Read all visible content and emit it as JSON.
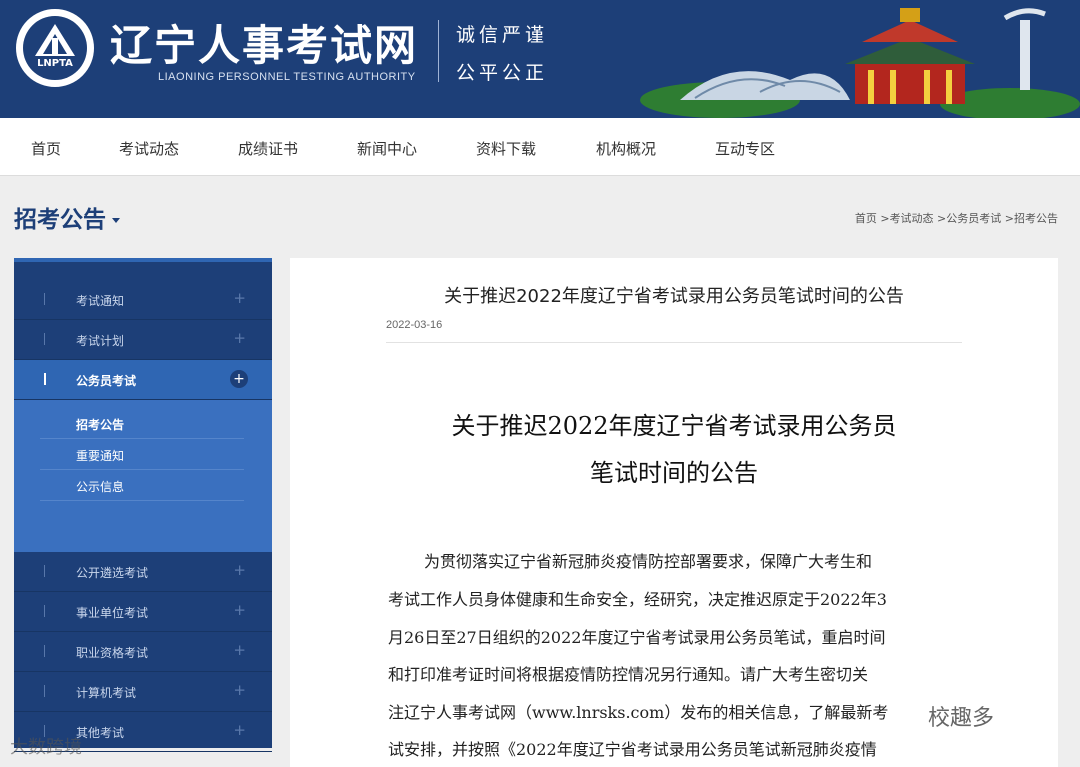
{
  "header": {
    "logo_text": "LNPTA",
    "site_title": "辽宁人事考试网",
    "site_subtitle": "LIAONING PERSONNEL TESTING AUTHORITY",
    "motto_line1": "诚信严谨",
    "motto_line2": "公平公正",
    "background_color": "#1d3f78"
  },
  "nav": {
    "items": [
      {
        "label": "首页"
      },
      {
        "label": "考试动态"
      },
      {
        "label": "成绩证书"
      },
      {
        "label": "新闻中心"
      },
      {
        "label": "资料下载"
      },
      {
        "label": "机构概况"
      },
      {
        "label": "互动专区"
      }
    ]
  },
  "section": {
    "title": "招考公告",
    "breadcrumb": [
      {
        "label": "首页"
      },
      {
        "label": "考试动态"
      },
      {
        "label": "公务员考试"
      },
      {
        "label": "招考公告"
      }
    ],
    "breadcrumb_separator": " >"
  },
  "sidebar": {
    "items": [
      {
        "label": "考试通知",
        "active": false
      },
      {
        "label": "考试计划",
        "active": false
      },
      {
        "label": "公务员考试",
        "active": true
      },
      {
        "label": "公开遴选考试",
        "active": false
      },
      {
        "label": "事业单位考试",
        "active": false
      },
      {
        "label": "职业资格考试",
        "active": false
      },
      {
        "label": "计算机考试",
        "active": false
      },
      {
        "label": "其他考试",
        "active": false
      }
    ],
    "subitems": [
      {
        "label": "招考公告",
        "current": true
      },
      {
        "label": "重要通知",
        "current": false
      },
      {
        "label": "公示信息",
        "current": false
      }
    ],
    "plus_glyph": "+",
    "accent_color": "#2f66b3"
  },
  "article": {
    "title": "关于推迟2022年度辽宁省考试录用公务员笔试时间的公告",
    "date": "2022-03-16",
    "doc_title_line1": "关于推迟2022年度辽宁省考试录用公务员",
    "doc_title_line2": "笔试时间的公告",
    "body_lines": [
      "为贯彻落实辽宁省新冠肺炎疫情防控部署要求，保障广大考生和",
      "考试工作人员身体健康和生命安全，经研究，决定推迟原定于2022年3",
      "月26日至27日组织的2022年度辽宁省考试录用公务员笔试，重启时间",
      "和打印准考证时间将根据疫情防控情况另行通知。请广大考生密切关",
      "注辽宁人事考试网（www.lnrsks.com）发布的相关信息，了解最新考",
      "试安排，并按照《2022年度辽宁省考试录用公务员笔试新冠肺炎疫情"
    ]
  },
  "watermarks": {
    "right": "校趣多",
    "left": "大数跨境"
  }
}
